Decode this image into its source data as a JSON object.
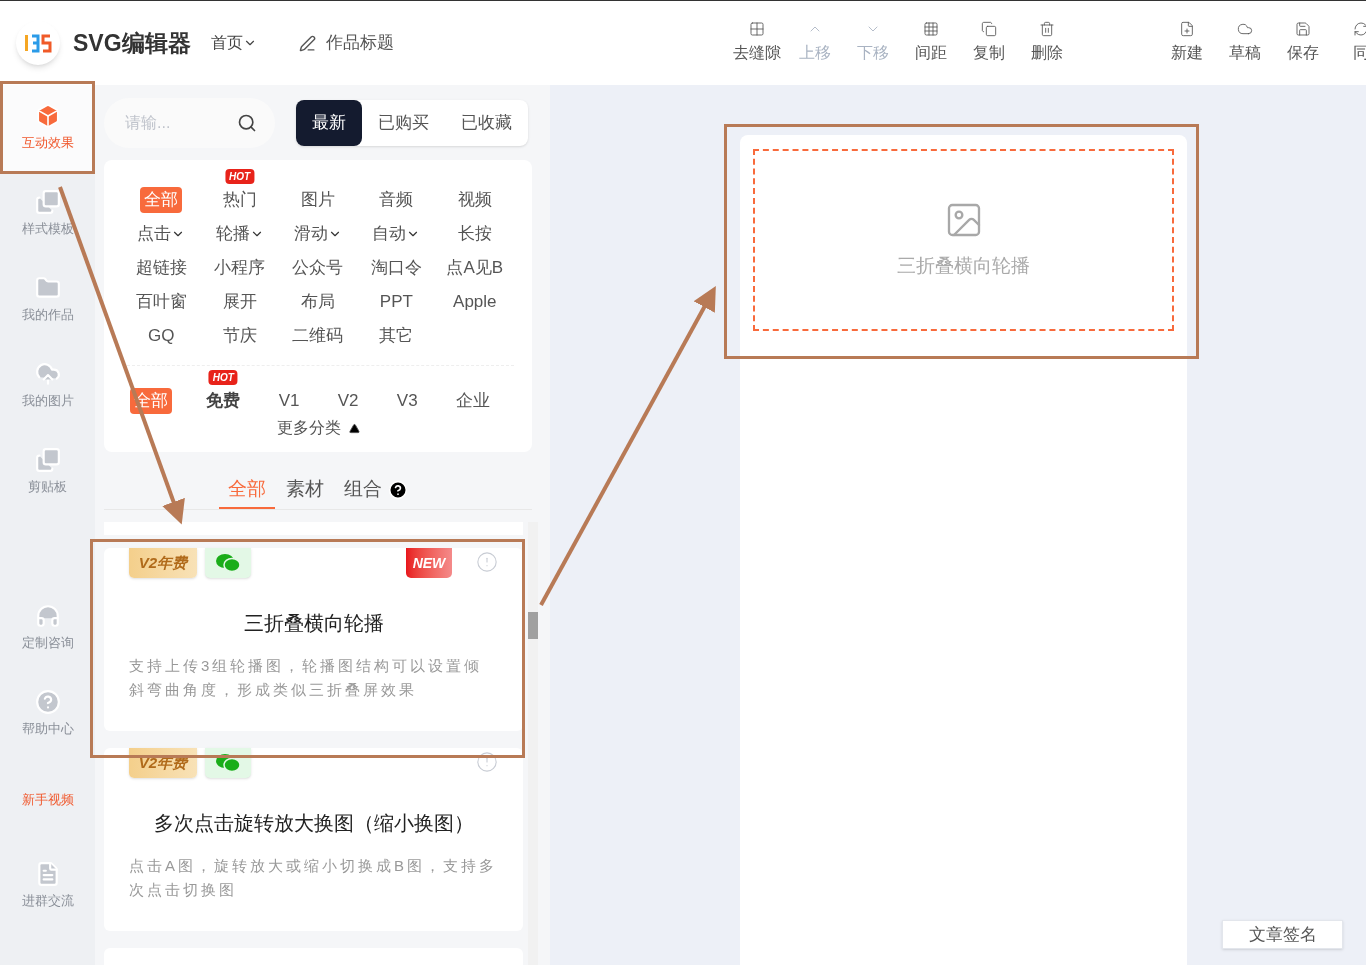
{
  "header": {
    "logo_text": "SVG编辑器",
    "nav": "首页",
    "title_field": "作品标题",
    "tools": [
      {
        "label": "去缝隙",
        "kind": "gap",
        "disabled": false
      },
      {
        "label": "上移",
        "kind": "up",
        "disabled": true
      },
      {
        "label": "下移",
        "kind": "down",
        "disabled": true
      },
      {
        "label": "间距",
        "kind": "spacing",
        "disabled": false
      },
      {
        "label": "复制",
        "kind": "copy",
        "disabled": false
      },
      {
        "label": "删除",
        "kind": "delete",
        "disabled": false
      }
    ],
    "actions": [
      {
        "label": "新建",
        "kind": "new"
      },
      {
        "label": "草稿",
        "kind": "draft"
      },
      {
        "label": "保存",
        "kind": "save"
      },
      {
        "label": "同",
        "kind": "sync"
      }
    ]
  },
  "sidebar": {
    "items": [
      {
        "label": "互动效果",
        "kind": "cube",
        "selected": true,
        "highlight": false
      },
      {
        "label": "样式模板",
        "kind": "images",
        "selected": false,
        "highlight": false
      },
      {
        "label": "我的作品",
        "kind": "folder",
        "selected": false,
        "highlight": false
      },
      {
        "label": "我的图片",
        "kind": "upload",
        "selected": false,
        "highlight": false
      },
      {
        "label": "剪贴板",
        "kind": "images",
        "selected": false,
        "highlight": false
      },
      {
        "label": "定制咨询",
        "kind": "headset",
        "selected": false,
        "highlight": false
      },
      {
        "label": "帮助中心",
        "kind": "help",
        "selected": false,
        "highlight": false
      },
      {
        "label": "新手视频",
        "kind": "none",
        "selected": false,
        "highlight": true
      },
      {
        "label": "进群交流",
        "kind": "file",
        "selected": false,
        "highlight": false
      }
    ]
  },
  "search": {
    "placeholder": "请输..."
  },
  "filter_tabs": [
    {
      "label": "最新",
      "selected": true
    },
    {
      "label": "已购买",
      "selected": false
    },
    {
      "label": "已收藏",
      "selected": false
    }
  ],
  "categories": [
    {
      "label": "全部",
      "selected": true,
      "dropdown": false
    },
    {
      "label": "热门",
      "selected": false,
      "dropdown": false,
      "badge": "HOT"
    },
    {
      "label": "图片",
      "selected": false,
      "dropdown": false
    },
    {
      "label": "音频",
      "selected": false,
      "dropdown": false
    },
    {
      "label": "视频",
      "selected": false,
      "dropdown": false
    },
    {
      "label": "点击",
      "selected": false,
      "dropdown": true
    },
    {
      "label": "轮播",
      "selected": false,
      "dropdown": true
    },
    {
      "label": "滑动",
      "selected": false,
      "dropdown": true
    },
    {
      "label": "自动",
      "selected": false,
      "dropdown": true
    },
    {
      "label": "长按",
      "selected": false,
      "dropdown": false
    },
    {
      "label": "超链接",
      "selected": false,
      "dropdown": false
    },
    {
      "label": "小程序",
      "selected": false,
      "dropdown": false
    },
    {
      "label": "公众号",
      "selected": false,
      "dropdown": false
    },
    {
      "label": "淘口令",
      "selected": false,
      "dropdown": false
    },
    {
      "label": "点A见B",
      "selected": false,
      "dropdown": false
    },
    {
      "label": "百叶窗",
      "selected": false,
      "dropdown": false
    },
    {
      "label": "展开",
      "selected": false,
      "dropdown": false
    },
    {
      "label": "布局",
      "selected": false,
      "dropdown": false
    },
    {
      "label": "PPT",
      "selected": false,
      "dropdown": false
    },
    {
      "label": "Apple",
      "selected": false,
      "dropdown": false
    },
    {
      "label": "GQ",
      "selected": false,
      "dropdown": false
    },
    {
      "label": "节庆",
      "selected": false,
      "dropdown": false
    },
    {
      "label": "二维码",
      "selected": false,
      "dropdown": false
    },
    {
      "label": "其它",
      "selected": false,
      "dropdown": false
    }
  ],
  "tiers": [
    {
      "label": "全部",
      "selected": true
    },
    {
      "label": "免费",
      "selected": false,
      "badge": "HOT"
    },
    {
      "label": "V1",
      "selected": false
    },
    {
      "label": "V2",
      "selected": false
    },
    {
      "label": "V3",
      "selected": false
    },
    {
      "label": "企业",
      "selected": false
    }
  ],
  "more_categories": {
    "label": "更多分类",
    "expanded": true
  },
  "sub_tabs": [
    {
      "label": "全部",
      "selected": true,
      "help": false
    },
    {
      "label": "素材",
      "selected": false,
      "help": false
    },
    {
      "label": "组合",
      "selected": false,
      "help": true
    }
  ],
  "templates": [
    {
      "tier_badge": "V2年费",
      "wechat": true,
      "new_badge": "NEW",
      "title": "三折叠横向轮播",
      "description": "支持上传3组轮播图，轮播图结构可以设置倾斜弯曲角度，形成类似三折叠屏效果"
    },
    {
      "tier_badge": "V2年费",
      "wechat": true,
      "title": "多次点击旋转放大换图（缩小换图）",
      "description": "点击A图，旋转放大或缩小切换成B图，支持多次点击切换图"
    }
  ],
  "canvas": {
    "placeholder_label": "三折叠横向轮播",
    "signature_button": "文章签名"
  }
}
